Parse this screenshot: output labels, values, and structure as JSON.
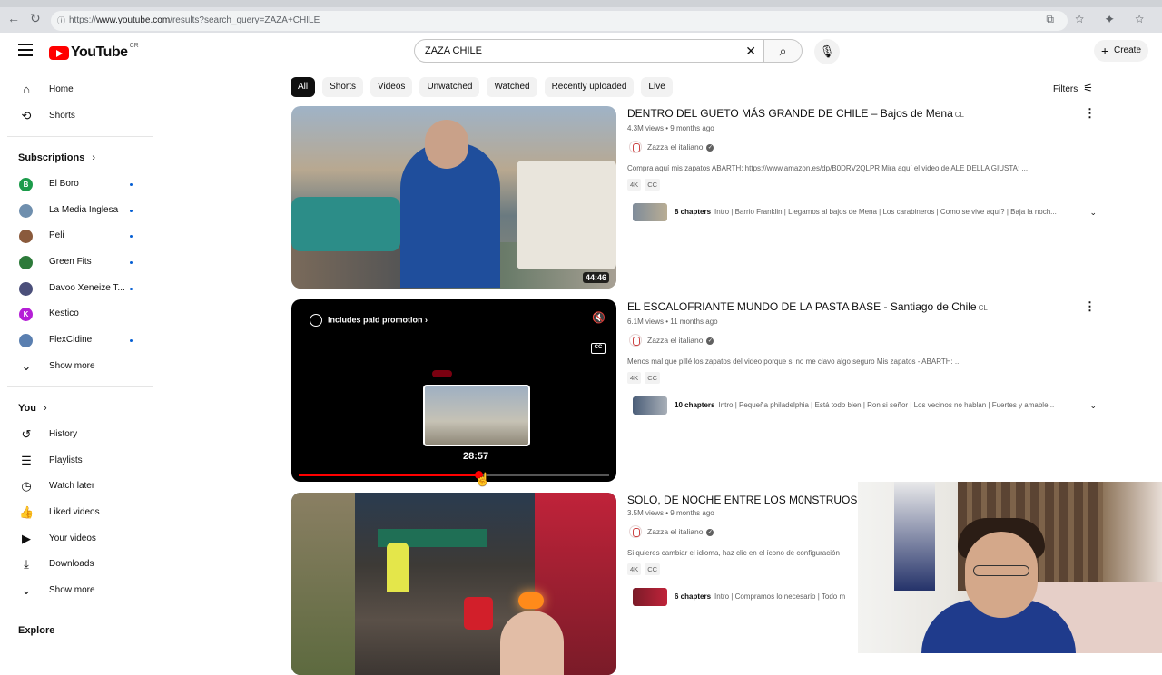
{
  "browser": {
    "url_prefix": "https://",
    "url_domain": "www.youtube.com",
    "url_path": "/results?search_query=ZAZA+CHILE"
  },
  "header": {
    "logo_text": "YouTube",
    "country": "CR",
    "search_value": "ZAZA CHILE",
    "create_label": "Create"
  },
  "sidebar": {
    "main": [
      {
        "label": "Home",
        "icon": "home-icon"
      },
      {
        "label": "Shorts",
        "icon": "shorts-icon"
      }
    ],
    "subscriptions_heading": "Subscriptions",
    "subscriptions": [
      {
        "label": "El Boro",
        "avatar": "B",
        "color": "#1b9b4a"
      },
      {
        "label": "La Media Inglesa",
        "avatar": "",
        "color": "#6f8fae"
      },
      {
        "label": "Peli",
        "avatar": "",
        "color": "#8a5a3c"
      },
      {
        "label": "Green Fits",
        "avatar": "",
        "color": "#2d7a3a"
      },
      {
        "label": "Davoo Xeneize T...",
        "avatar": "",
        "color": "#4b4f7a"
      },
      {
        "label": "Kestico",
        "avatar": "K",
        "color": "#b51fd6"
      },
      {
        "label": "FlexCidine",
        "avatar": "",
        "color": "#5a7fb0"
      }
    ],
    "show_more_1": "Show more",
    "you_heading": "You",
    "you_items": [
      {
        "label": "History",
        "icon": "history-icon"
      },
      {
        "label": "Playlists",
        "icon": "playlists-icon"
      },
      {
        "label": "Watch later",
        "icon": "watch-later-icon"
      },
      {
        "label": "Liked videos",
        "icon": "like-icon"
      },
      {
        "label": "Your videos",
        "icon": "your-videos-icon"
      },
      {
        "label": "Downloads",
        "icon": "download-icon"
      }
    ],
    "show_more_2": "Show more",
    "explore_heading": "Explore"
  },
  "chips": [
    "All",
    "Shorts",
    "Videos",
    "Unwatched",
    "Watched",
    "Recently uploaded",
    "Live"
  ],
  "filters_label": "Filters",
  "results": [
    {
      "title": "DENTRO DEL GUETO MÁS GRANDE DE CHILE – Bajos de Mena",
      "lang": "CL",
      "views": "4.3M views",
      "age": "9 months ago",
      "channel": "Zazza el italiano",
      "description": "Compra aquí mis zapatos ABARTH: https://www.amazon.es/dp/B0DRV2QLPR Mira aquí el video de ALE DELLA GIUSTA: ...",
      "badges": [
        "4K",
        "CC"
      ],
      "chapters_count": "8 chapters",
      "chapters_text": "Intro | Barrio Franklin | Llegamos al bajos de Mena | Los carabineros | Como se vive aquí? | Baja la noch...",
      "duration": "44:46"
    },
    {
      "title": "EL ESCALOFRIANTE MUNDO DE LA PASTA BASE - Santiago de Chile",
      "lang": "CL",
      "views": "6.1M views",
      "age": "11 months ago",
      "channel": "Zazza el italiano",
      "description": "Menos mal que pillé los zapatos del video porque si no me clavo algo seguro Mis zapatos - ABARTH: ...",
      "badges": [
        "4K",
        "CC"
      ],
      "chapters_count": "10 chapters",
      "chapters_text": "Intro | Pequeña philadelphia | Está todo bien | Ron si señor | Los vecinos no hablan | Fuertes y amable...",
      "promo_label": "Includes paid promotion",
      "preview_time": "28:57",
      "progress_fraction": 0.58
    },
    {
      "title": "SOLO, DE NOCHE ENTRE LOS M0NSTRUOS D",
      "lang": "",
      "views": "3.5M views",
      "age": "9 months ago",
      "channel": "Zazza el italiano",
      "description": "Si quieres cambiar el idioma, haz clic en el ícono de configuración",
      "badges": [
        "4K",
        "CC"
      ],
      "chapters_count": "6 chapters",
      "chapters_text": "Intro | Compramos lo necesario | Todo m"
    }
  ]
}
